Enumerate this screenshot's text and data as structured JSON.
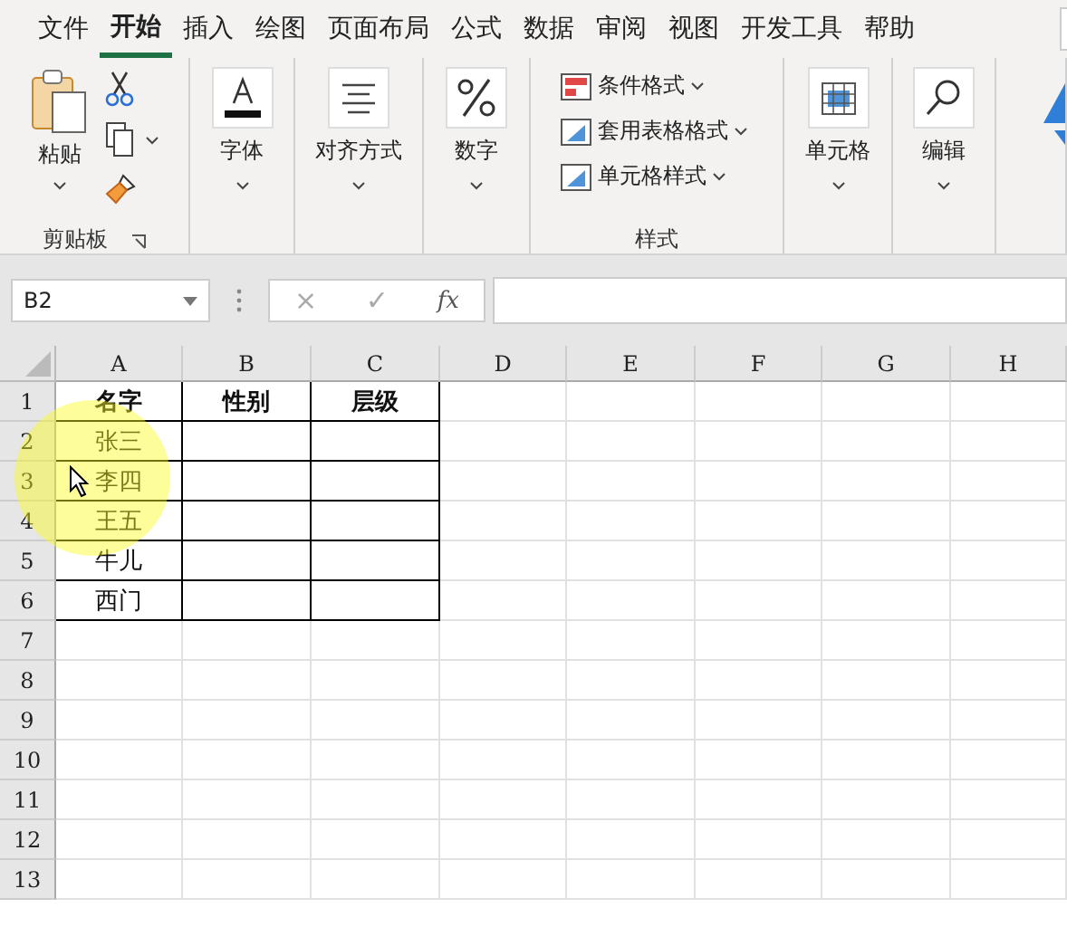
{
  "tabs": [
    {
      "label": "文件",
      "selected": false
    },
    {
      "label": "开始",
      "selected": true
    },
    {
      "label": "插入",
      "selected": false
    },
    {
      "label": "绘图",
      "selected": false
    },
    {
      "label": "页面布局",
      "selected": false
    },
    {
      "label": "公式",
      "selected": false
    },
    {
      "label": "数据",
      "selected": false
    },
    {
      "label": "审阅",
      "selected": false
    },
    {
      "label": "视图",
      "selected": false
    },
    {
      "label": "开发工具",
      "selected": false
    },
    {
      "label": "帮助",
      "selected": false
    }
  ],
  "ribbon": [
    {
      "kind": "clipboard",
      "button": "粘贴",
      "label": "剪贴板"
    },
    {
      "kind": "font",
      "button": "字体"
    },
    {
      "kind": "align",
      "button": "对齐方式"
    },
    {
      "kind": "number",
      "button": "数字"
    },
    {
      "kind": "styles",
      "items": [
        "条件格式",
        "套用表格格式",
        "单元格样式"
      ],
      "label": "样式"
    },
    {
      "kind": "cells",
      "button": "单元格"
    },
    {
      "kind": "edit",
      "button": "编辑"
    },
    {
      "kind": "partial"
    }
  ],
  "formula_bar": {
    "name_box": "B2",
    "cancel": "×",
    "enter": "✓",
    "fx": "fx"
  },
  "columns": [
    "A",
    "B",
    "C",
    "D",
    "E",
    "F",
    "G",
    "H"
  ],
  "rows": [
    "1",
    "2",
    "3",
    "4",
    "5",
    "6",
    "7",
    "8",
    "9",
    "10",
    "11",
    "12",
    "13"
  ],
  "table": {
    "header": [
      "名字",
      "性别",
      "层级"
    ],
    "names": [
      "张三",
      "李四",
      "王五",
      "牛儿",
      "西门"
    ]
  }
}
